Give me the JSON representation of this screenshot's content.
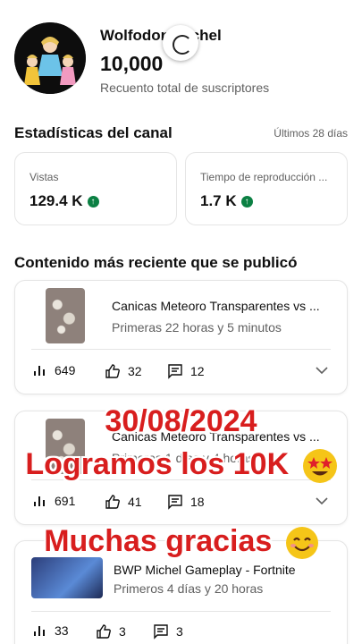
{
  "channel": {
    "name": "Wolfodon Michel",
    "subscribers": "10,000",
    "subscribers_label": "Recuento total de suscriptores"
  },
  "stats": {
    "title": "Estadísticas del canal",
    "period": "Últimos 28 días",
    "views_label": "Vistas",
    "views_value": "129.4 K",
    "watch_label": "Tiempo de reproducción ...",
    "watch_value": "1.7 K"
  },
  "recent": {
    "title": "Contenido más reciente que se publicó",
    "videos": [
      {
        "title": "Canicas Meteoro Transparentes vs ...",
        "subtitle": "Primeras 22 horas y 5 minutos",
        "views": "649",
        "likes": "32",
        "comments": "12"
      },
      {
        "title": "Canicas Meteoro Transparentes vs ...",
        "subtitle": "Primeras 1 días y 4 horas",
        "views": "691",
        "likes": "41",
        "comments": "18"
      },
      {
        "title": "BWP Michel Gameplay - Fortnite",
        "subtitle": "Primeros 4 días y 20 horas",
        "views": "33",
        "likes": "3",
        "comments": "3"
      }
    ]
  },
  "overlay": {
    "date": "30/08/2024",
    "milestone": "Logramos los 10K",
    "thanks": "Muchas gracias"
  },
  "colors": {
    "accent": "#d81e1e",
    "up": "#0b8043"
  }
}
